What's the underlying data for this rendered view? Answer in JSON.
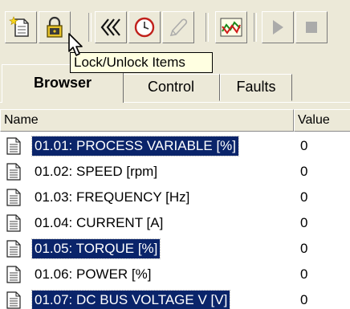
{
  "toolbar": {
    "buttons": [
      {
        "name": "new-item-button",
        "icon": "new-document-icon"
      },
      {
        "name": "lock-unlock-button",
        "icon": "lock-icon"
      },
      {
        "name": "rewind-button",
        "icon": "double-chevron-left-icon"
      },
      {
        "name": "clock-button",
        "icon": "clock-icon"
      },
      {
        "name": "edit-button",
        "icon": "pen-icon"
      },
      {
        "name": "trend-button",
        "icon": "trend-chart-icon"
      },
      {
        "name": "play-button",
        "icon": "play-icon"
      },
      {
        "name": "stop-button",
        "icon": "stop-icon"
      }
    ],
    "tooltip": "Lock/Unlock Items"
  },
  "tabs": [
    {
      "label": "Browser",
      "active": true
    },
    {
      "label": "Control",
      "active": false
    },
    {
      "label": "Faults",
      "active": false
    }
  ],
  "list": {
    "columns": {
      "name": "Name",
      "value": "Value"
    },
    "rows": [
      {
        "name": "01.01: PROCESS VARIABLE [%]",
        "value": "0",
        "selected": true
      },
      {
        "name": "01.02: SPEED [rpm]",
        "value": "0",
        "selected": false
      },
      {
        "name": "01.03: FREQUENCY [Hz]",
        "value": "0",
        "selected": false
      },
      {
        "name": "01.04: CURRENT [A]",
        "value": "0",
        "selected": false
      },
      {
        "name": "01.05: TORQUE [%]",
        "value": "0",
        "selected": true
      },
      {
        "name": "01.06: POWER [%]",
        "value": "0",
        "selected": false
      },
      {
        "name": "01.07: DC BUS VOLTAGE V [V]",
        "value": "0",
        "selected": true
      }
    ]
  },
  "colors": {
    "selection": "#0a246a",
    "tooltip_bg": "#ffffe1",
    "chrome": "#ece9d8"
  }
}
